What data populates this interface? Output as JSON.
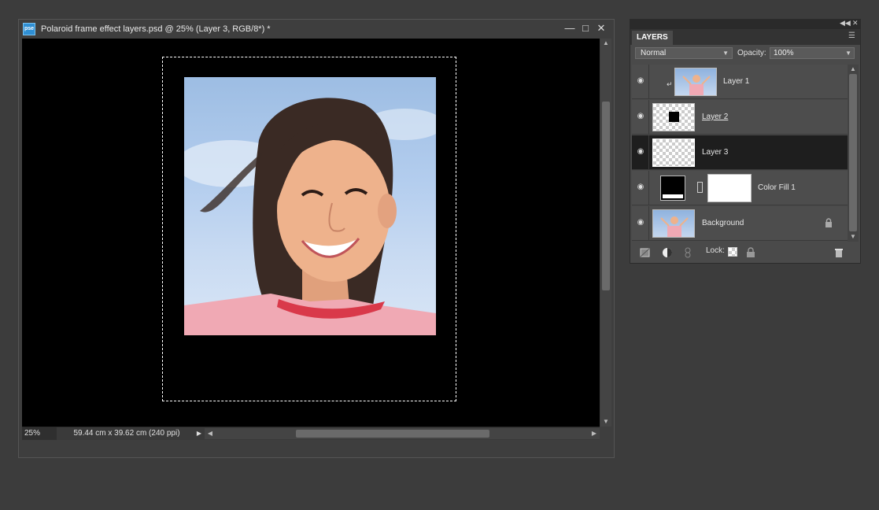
{
  "document": {
    "app_badge": "pse",
    "title": "Polaroid frame effect layers.psd @ 25% (Layer 3, RGB/8*) *",
    "zoom": "25%",
    "doc_size": "59.44 cm x 39.62 cm (240 ppi)"
  },
  "layers_panel": {
    "tab": "LAYERS",
    "blend_mode": "Normal",
    "opacity_label": "Opacity:",
    "opacity_value": "100%",
    "lock_label": "Lock:",
    "layers": [
      {
        "name": "Layer 1",
        "thumb": "photo",
        "selected": false,
        "clipped": true
      },
      {
        "name": "Layer 2",
        "thumb": "black-square",
        "selected": false
      },
      {
        "name": "Layer 3",
        "thumb": "transparent",
        "selected": true
      },
      {
        "name": "Color Fill 1",
        "thumb": "fill-with-mask",
        "selected": false
      },
      {
        "name": "Background",
        "thumb": "photo",
        "selected": false,
        "locked": true
      }
    ]
  },
  "colors": {
    "panel_bg": "#4a4a4a",
    "selected_row": "#1e1e1e",
    "canvas_bg": "#000000",
    "app_bg": "#3c3c3c"
  }
}
